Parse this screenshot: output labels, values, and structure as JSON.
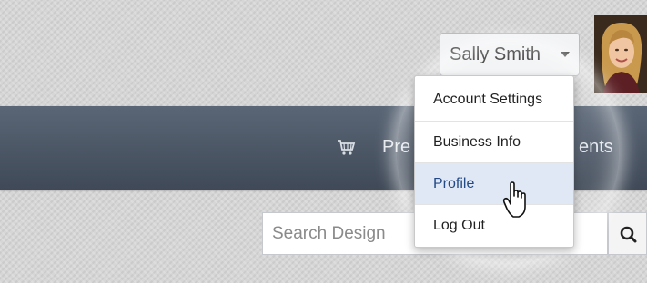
{
  "navbar": {
    "links": [
      "Pre",
      "ents"
    ],
    "cart_icon": "shopping-cart-icon"
  },
  "user_menu": {
    "name": "Sally Smith",
    "items": [
      "Account Settings",
      "Business Info",
      "Profile",
      "Log Out"
    ],
    "highlighted": "Profile"
  },
  "search": {
    "placeholder": "Search Design",
    "icon": "search-icon"
  },
  "cursor": "hand-pointer-icon",
  "colors": {
    "navbar_bg": "#4a5463",
    "highlight_bg": "#dfe8f4",
    "highlight_text": "#234a87"
  }
}
